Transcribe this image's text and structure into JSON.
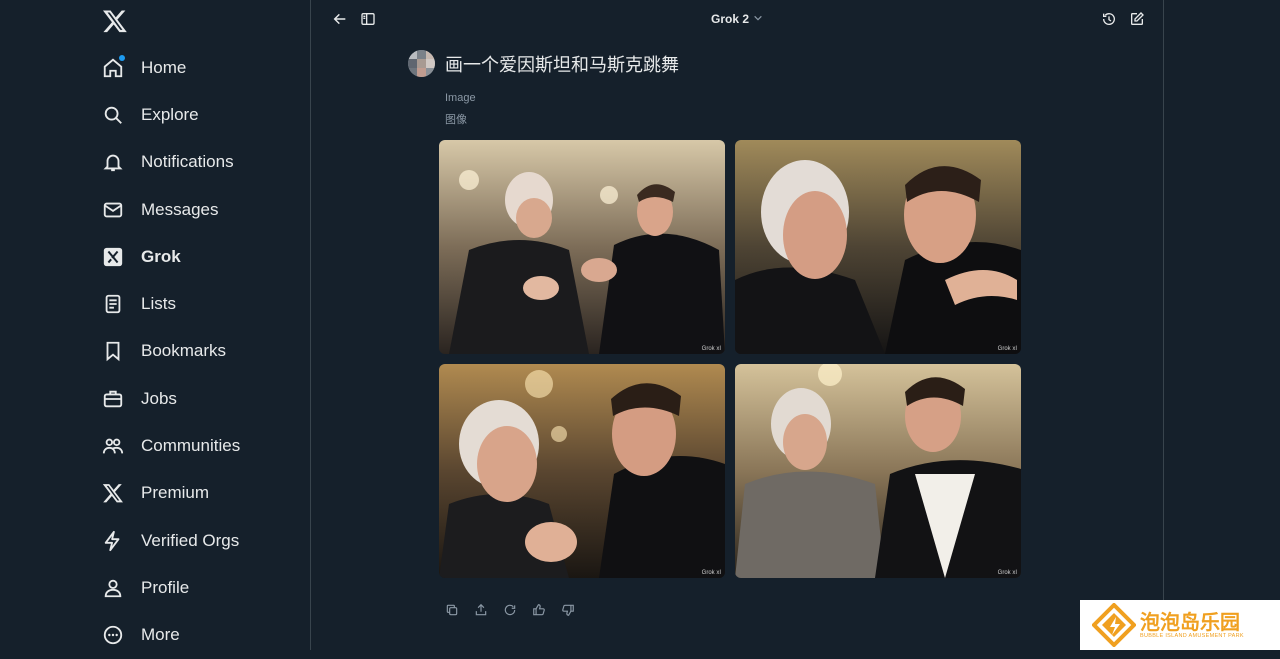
{
  "sidebar": {
    "logo": "x-logo-icon",
    "items": [
      {
        "label": "Home",
        "icon": "home-icon"
      },
      {
        "label": "Explore",
        "icon": "search-icon"
      },
      {
        "label": "Notifications",
        "icon": "bell-icon"
      },
      {
        "label": "Messages",
        "icon": "mail-icon"
      },
      {
        "label": "Grok",
        "icon": "grok-icon"
      },
      {
        "label": "Lists",
        "icon": "list-icon"
      },
      {
        "label": "Bookmarks",
        "icon": "bookmark-icon"
      },
      {
        "label": "Jobs",
        "icon": "briefcase-icon"
      },
      {
        "label": "Communities",
        "icon": "people-icon"
      },
      {
        "label": "Premium",
        "icon": "x-logo-icon"
      },
      {
        "label": "Verified Orgs",
        "icon": "lightning-icon"
      },
      {
        "label": "Profile",
        "icon": "person-icon"
      },
      {
        "label": "More",
        "icon": "more-icon"
      }
    ]
  },
  "topbar": {
    "model": "Grok 2"
  },
  "conversation": {
    "prompt": "画一个爱因斯坦和马斯克跳舞",
    "result_type": "Image",
    "result_type_cn": "图像",
    "watermark": "Grok xI"
  },
  "colors": {
    "background": "#15202b",
    "border": "#38444d",
    "accent": "#1d9bf0",
    "badge_orange": "#f0a020"
  },
  "badge": {
    "title": "泡泡岛乐园",
    "subtitle": "BUBBLE ISLAND AMUSEMENT PARK"
  }
}
